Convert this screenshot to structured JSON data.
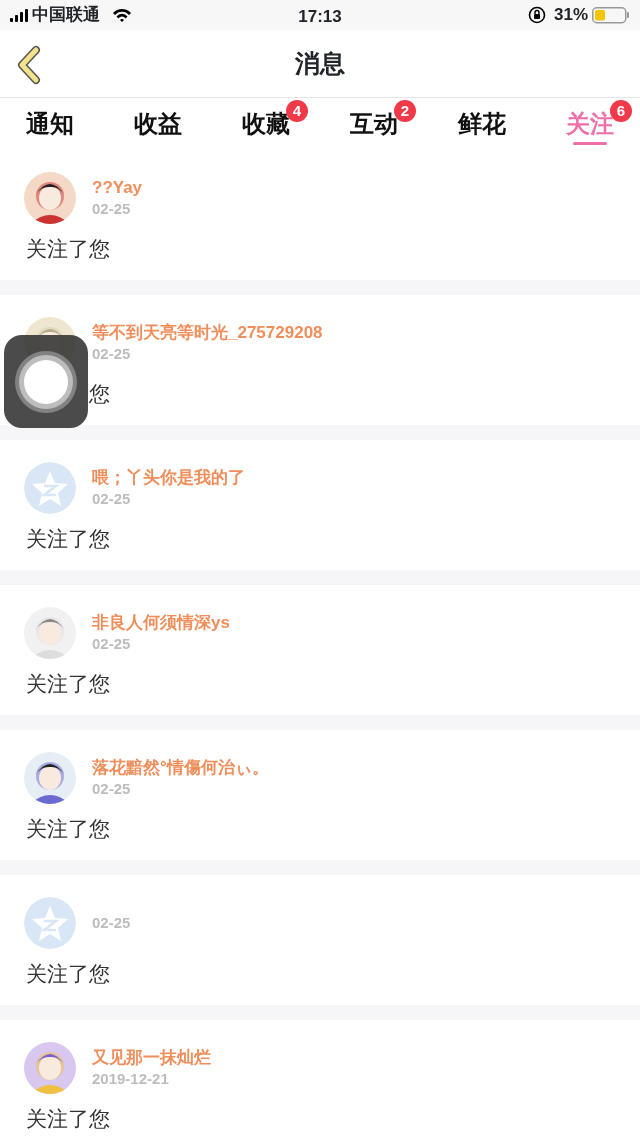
{
  "status_bar": {
    "carrier": "中国联通",
    "time": "17:13",
    "battery": "31%"
  },
  "header": {
    "title": "消息"
  },
  "tabs": [
    {
      "label": "通知",
      "selected": false
    },
    {
      "label": "收益",
      "selected": false
    },
    {
      "label": "收藏",
      "selected": false,
      "badge": "4"
    },
    {
      "label": "互动",
      "selected": false,
      "badge": "2"
    },
    {
      "label": "鲜花",
      "selected": false
    },
    {
      "label": "关注",
      "selected": true,
      "badge": "6"
    }
  ],
  "items": [
    {
      "kind": "picture",
      "name": "??Yay",
      "date": "02-25",
      "message": "关注了您"
    },
    {
      "kind": "picture",
      "name": "等不到天亮等时光_275729208",
      "date": "02-25",
      "message": "您"
    },
    {
      "kind": "default",
      "name": "喂；丫头你是我的了",
      "date": "02-25",
      "message": "关注了您"
    },
    {
      "kind": "picture",
      "name": "非良人何须情深ys",
      "date": "02-25",
      "message": "关注了您"
    },
    {
      "kind": "picture",
      "name": "落花黯然°情傷何治ぃ。",
      "date": "02-25",
      "message": "关注了您"
    },
    {
      "kind": "default",
      "date": "02-25",
      "message": "关注了您"
    },
    {
      "kind": "picture",
      "name": "又见那一抹灿烂",
      "date": "2019-12-21",
      "message": "关注了您"
    }
  ]
}
